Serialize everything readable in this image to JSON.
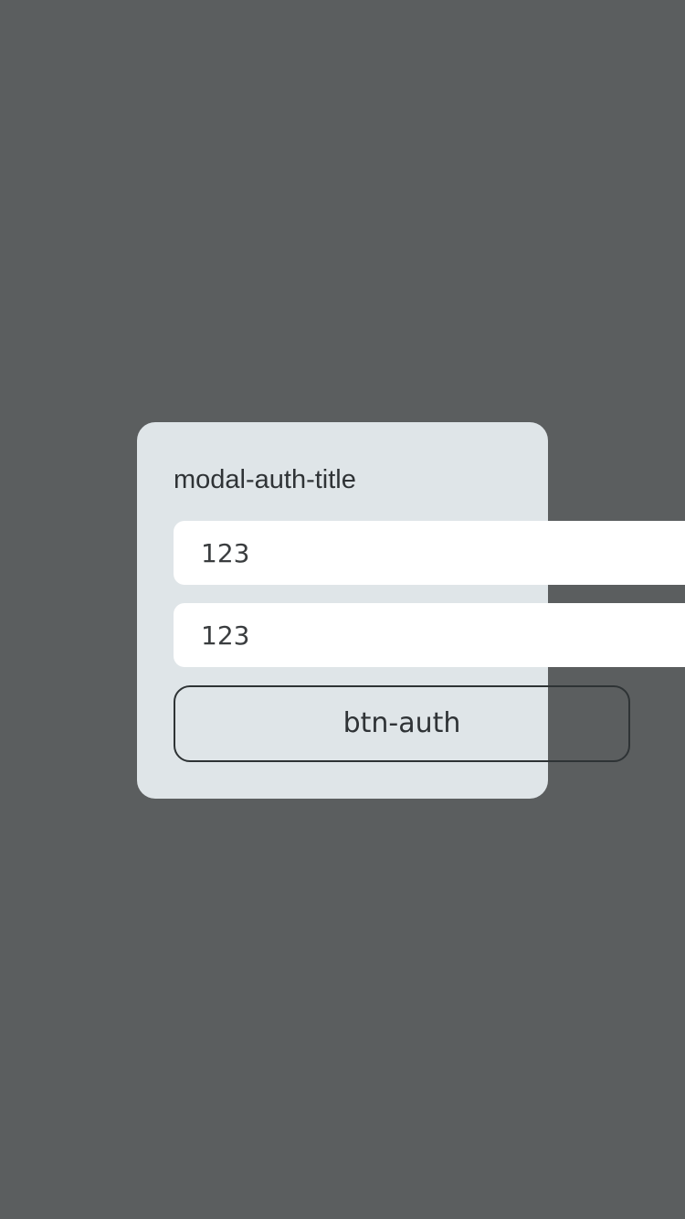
{
  "modal": {
    "title": "modal-auth-title",
    "login_field": {
      "value": "123"
    },
    "password_field": {
      "value": "123"
    },
    "submit_label": "btn-auth"
  },
  "colors": {
    "backdrop": "#5b5e5f",
    "modal_background": "#dfe5e8",
    "input_background": "#ffffff",
    "text": "#2f3336"
  }
}
